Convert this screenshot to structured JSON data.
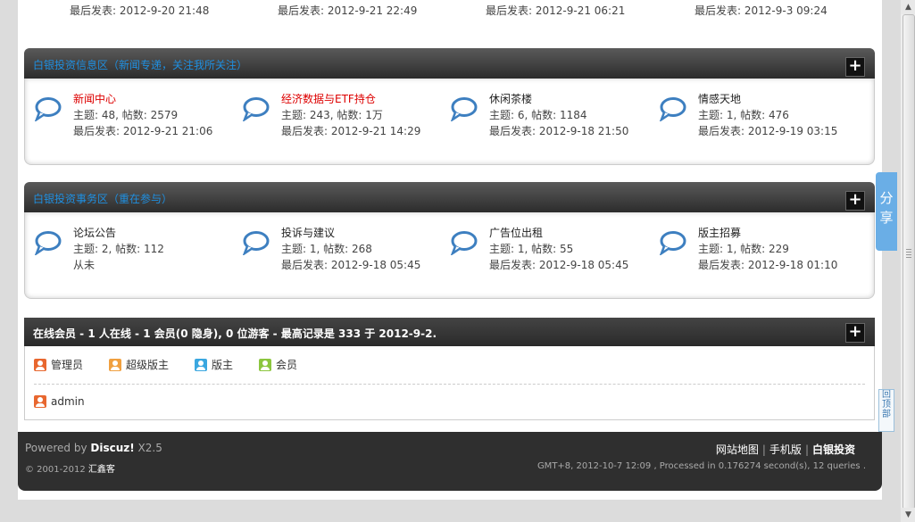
{
  "top_row": [
    "最后发表: 2012-9-20 21:48",
    "最后发表: 2012-9-21 22:49",
    "最后发表: 2012-9-21 06:21",
    "最后发表: 2012-9-3 09:24"
  ],
  "categories": [
    {
      "title": "白银投资信息区（新闻专递，关注我所关注）",
      "toggle": "+",
      "forums": [
        {
          "name": "新闻中心",
          "hot": true,
          "stats": "主题: 48, 帖数: 2579",
          "last": "最后发表: 2012-9-21 21:06"
        },
        {
          "name": "经济数据与ETF持仓",
          "hot": true,
          "stats": "主题: 243, 帖数: 1万",
          "last": "最后发表: 2012-9-21 14:29"
        },
        {
          "name": "休闲茶楼",
          "hot": false,
          "stats": "主题: 6, 帖数: 1184",
          "last": "最后发表: 2012-9-18 21:50"
        },
        {
          "name": "情感天地",
          "hot": false,
          "stats": "主题: 1, 帖数: 476",
          "last": "最后发表: 2012-9-19 03:15"
        }
      ]
    },
    {
      "title": "白银投资事务区（重在参与）",
      "toggle": "+",
      "forums": [
        {
          "name": "论坛公告",
          "hot": false,
          "stats": "主题: 2, 帖数: 112",
          "last": "从未"
        },
        {
          "name": "投诉与建议",
          "hot": false,
          "stats": "主题: 1, 帖数: 268",
          "last": "最后发表: 2012-9-18 05:45"
        },
        {
          "name": "广告位出租",
          "hot": false,
          "stats": "主题: 1, 帖数: 55",
          "last": "最后发表: 2012-9-18 05:45"
        },
        {
          "name": "版主招募",
          "hot": false,
          "stats": "主题: 1, 帖数: 229",
          "last": "最后发表: 2012-9-18 01:10"
        }
      ]
    }
  ],
  "online": {
    "title": "在线会员 - 1 人在线 - 1 会员(0 隐身), 0 位游客 - 最高记录是 333 于 2012-9-2.",
    "toggle": "+",
    "legend": [
      {
        "label": "管理员",
        "color": "#e8672f"
      },
      {
        "label": "超级版主",
        "color": "#f0a040"
      },
      {
        "label": "版主",
        "color": "#3aa7e0"
      },
      {
        "label": "会员",
        "color": "#8cc63f"
      }
    ],
    "users": [
      {
        "name": "admin",
        "color": "#e8672f"
      }
    ]
  },
  "footer": {
    "powered_prefix": "Powered by ",
    "powered_brand": "Discuz!",
    "powered_version": " X2.5",
    "copyright_prefix": "© 2001-2012 ",
    "copyright_brand": "汇鑫客",
    "links": [
      "网站地图",
      "手机版"
    ],
    "site_name": "白银投资",
    "sep": "|",
    "gmt": "GMT+8, 2012-10-7 12:09 , Processed in 0.176274 second(s), 12 queries ."
  },
  "share": {
    "c1": "分",
    "c2": "享"
  },
  "backtop": {
    "c1": "回",
    "c2": "顶",
    "c3": "部"
  },
  "colors": {
    "link_blue": "#1f8fe0",
    "hot_red": "#dd0000",
    "bubble": "#3d7fc0"
  }
}
